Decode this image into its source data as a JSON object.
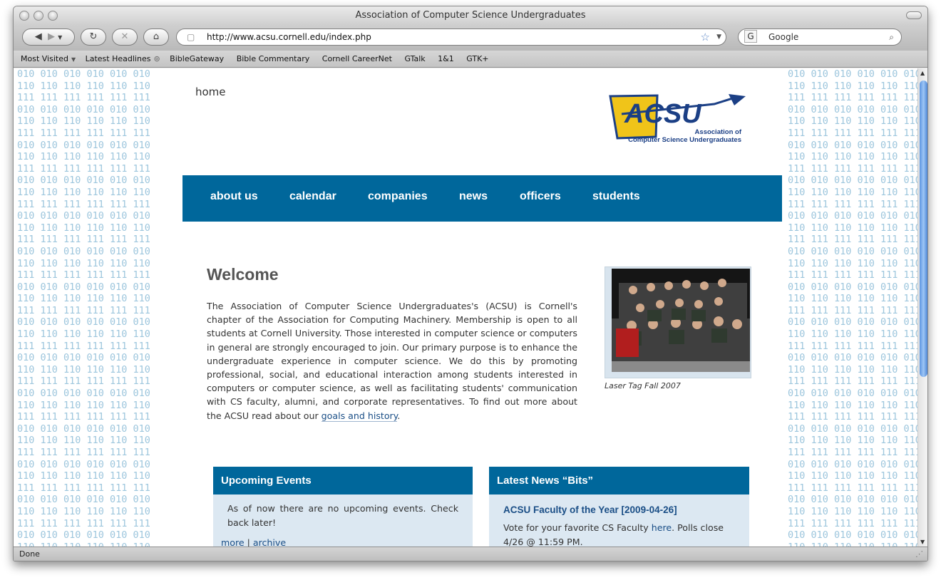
{
  "browser": {
    "window_title": "Association of Computer Science Undergraduates",
    "url": "http://www.acsu.cornell.edu/index.php",
    "search_engine": "Google",
    "status": "Done",
    "bookmarks": [
      "Most Visited",
      "Latest Headlines",
      "BibleGateway",
      "Bible Commentary",
      "Cornell CareerNet",
      "GTalk",
      "1&1",
      "GTK+"
    ]
  },
  "background_pattern": [
    "010 010 010 010 010 010",
    "110 110 110 110 110 110",
    "111 111 111 111 111 111"
  ],
  "page": {
    "home_link": "home",
    "logo": {
      "text": "ACSU",
      "line1": "Association of",
      "line2": "Computer Science Undergraduates"
    },
    "nav": [
      "about us",
      "calendar",
      "companies",
      "news",
      "officers",
      "students"
    ],
    "welcome_title": "Welcome",
    "intro_text": "The Association of Computer Science Undergraduates's (ACSU) is Cornell's chapter of the Association for Computing Machinery. Membership is open to all students at Cornell University. Those interested in computer science or computers in general are strongly encouraged to join. Our primary purpose is to enhance the undergraduate experience in computer science. We do this by promoting professional, social, and educational interaction among students interested in computers or computer science, as well as facilitating students' communication with CS faculty, alumni, and corporate representatives. To find out more about the ACSU read about our",
    "intro_link": "goals and history",
    "intro_end": ".",
    "photo_caption": "Laser Tag Fall 2007",
    "events": {
      "title": "Upcoming Events",
      "text": "As of now there are no upcoming events. Check back later!",
      "more": "more",
      "sep": " | ",
      "archive": "archive"
    },
    "news": {
      "title": "Latest News “Bits”",
      "item_title": "ACSU Faculty of the Year [2009-04-26]",
      "item_text_before": "Vote for your favorite CS Faculty ",
      "item_link": "here",
      "item_text_after": ". Polls close 4/26 @ 11:59 PM."
    }
  },
  "colors": {
    "nav_blue": "#00679b",
    "box_bg": "#dce8f2",
    "binary": "#9dc6dd"
  }
}
